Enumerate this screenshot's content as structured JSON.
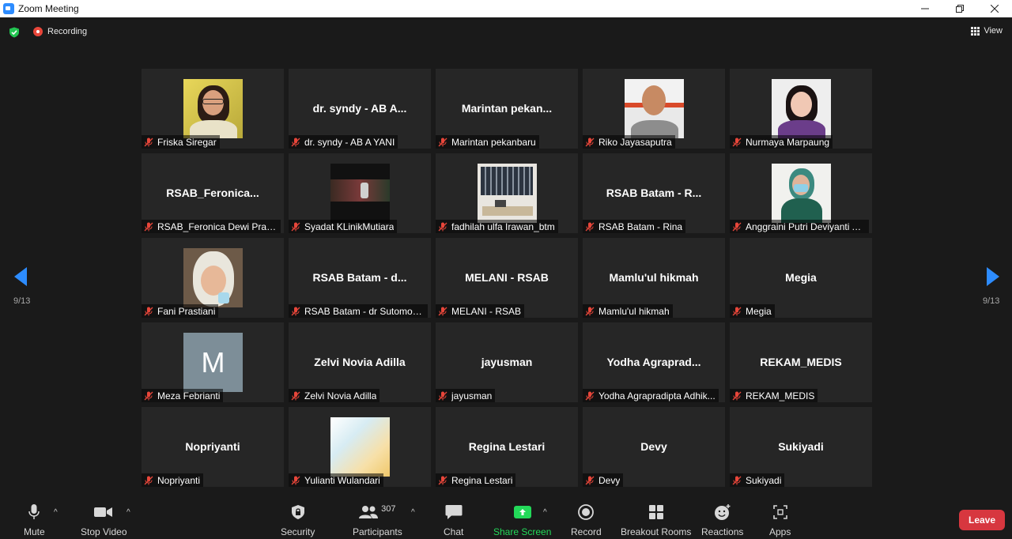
{
  "window": {
    "title": "Zoom Meeting"
  },
  "status": {
    "recording_label": "Recording",
    "view_label": "View"
  },
  "pagination": {
    "left": "9/13",
    "right": "9/13"
  },
  "tiles": [
    {
      "big": "",
      "name": "Friska Siregar",
      "video": "woman-glasses"
    },
    {
      "big": "dr. syndy - AB A...",
      "name": "dr. syndy - AB A YANI",
      "video": ""
    },
    {
      "big": "Marintan  pekan...",
      "name": "Marintan pekanbaru",
      "video": ""
    },
    {
      "big": "",
      "name": "Riko Jayasaputra",
      "video": "man-bald"
    },
    {
      "big": "",
      "name": "Nurmaya Marpaung",
      "video": "woman-bangs"
    },
    {
      "big": "RSAB_Feronica...",
      "name": "RSAB_Feronica Dewi Pratiwi",
      "video": ""
    },
    {
      "big": "",
      "name": "Syadat KLinikMutiara",
      "video": "dark-scene"
    },
    {
      "big": "",
      "name": "fadhilah ulfa Irawan_btm",
      "video": "office-shelf"
    },
    {
      "big": "RSAB Batam - R...",
      "name": "RSAB Batam - Rina",
      "video": ""
    },
    {
      "big": "",
      "name": "Anggraini Putri Deviyanti A...",
      "video": "woman-hijab-green"
    },
    {
      "big": "",
      "name": "Fani Prastiani",
      "video": "woman-hijab"
    },
    {
      "big": "RSAB Batam - d...",
      "name": "RSAB Batam - dr Sutomo, ...",
      "video": ""
    },
    {
      "big": "MELANI - RSAB",
      "name": "MELANI - RSAB",
      "video": ""
    },
    {
      "big": "Mamlu'ul hikmah",
      "name": "Mamlu'ul hikmah",
      "video": ""
    },
    {
      "big": "Megia",
      "name": "Megia",
      "video": ""
    },
    {
      "big": "",
      "name": "Meza Febrianti",
      "video": "avatar-m",
      "avatar_letter": "M"
    },
    {
      "big": "Zelvi Novia Adilla",
      "name": "Zelvi Novia Adilla",
      "video": ""
    },
    {
      "big": "jayusman",
      "name": "jayusman",
      "video": ""
    },
    {
      "big": "Yodha  Agraprad...",
      "name": "Yodha Agrapradipta Adhik...",
      "video": ""
    },
    {
      "big": "REKAM_MEDIS",
      "name": "REKAM_MEDIS",
      "video": ""
    },
    {
      "big": "Nopriyanti",
      "name": "Nopriyanti",
      "video": ""
    },
    {
      "big": "",
      "name": "Yulianti Wulandari",
      "video": "gradient"
    },
    {
      "big": "Regina Lestari",
      "name": "Regina Lestari",
      "video": ""
    },
    {
      "big": "Devy",
      "name": "Devy",
      "video": ""
    },
    {
      "big": "Sukiyadi",
      "name": "Sukiyadi",
      "video": ""
    }
  ],
  "toolbar": {
    "mute": "Mute",
    "stop_video": "Stop Video",
    "security": "Security",
    "participants": "Participants",
    "participants_count": "307",
    "chat": "Chat",
    "share_screen": "Share Screen",
    "record": "Record",
    "breakout_rooms": "Breakout Rooms",
    "reactions": "Reactions",
    "apps": "Apps",
    "leave": "Leave"
  },
  "colors": {
    "accent": "#2d8cff",
    "share": "#23d959",
    "leave": "#d7373f",
    "muted_mic": "#e8463a"
  }
}
